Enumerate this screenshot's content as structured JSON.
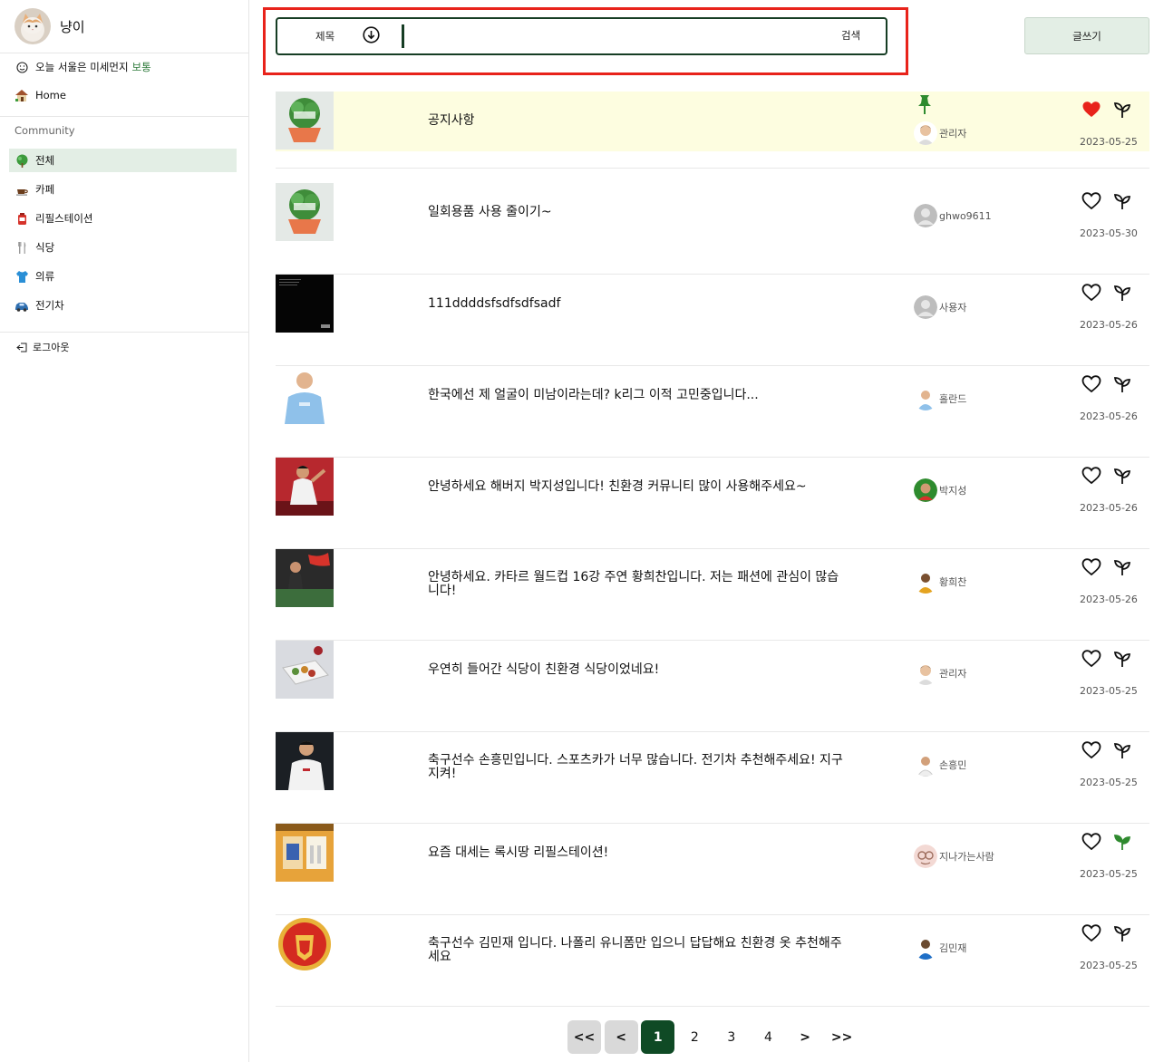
{
  "profile": {
    "name": "냥이"
  },
  "dust": {
    "text": "오늘 서울은 미세먼지",
    "status": "보통"
  },
  "nav": {
    "home": "Home",
    "logout": "로그아웃"
  },
  "community": {
    "label": "Community",
    "items": [
      {
        "label": "전체",
        "icon": "tree-icon",
        "active": true
      },
      {
        "label": "카페",
        "icon": "coffee-icon"
      },
      {
        "label": "리필스테이션",
        "icon": "refill-bottle-icon"
      },
      {
        "label": "식당",
        "icon": "utensils-icon"
      },
      {
        "label": "의류",
        "icon": "shirt-icon"
      },
      {
        "label": "전기차",
        "icon": "car-icon"
      }
    ]
  },
  "search": {
    "type": "제목",
    "placeholder": "",
    "button": "검색"
  },
  "write_button": "글쓰기",
  "colors": {
    "accent": "#0f4a25",
    "active_bg": "#e3eee5",
    "pinned_bg": "#fdfde0",
    "heart": "#e8231b",
    "sprout": "#2f8a2f",
    "highlight": "#e8231b"
  },
  "posts": [
    {
      "title": "공지사항",
      "author": "관리자",
      "date": "2023-05-25",
      "pinned": true,
      "liked": true,
      "sprouted": false
    },
    {
      "title": "일회용품 사용 줄이기~",
      "author": "ghwo9611",
      "date": "2023-05-30",
      "liked": false,
      "sprouted": false
    },
    {
      "title": "111ddddsfsdfsdfsadf",
      "author": "사용자",
      "date": "2023-05-26",
      "liked": false,
      "sprouted": false
    },
    {
      "title": "한국에선 제 얼굴이 미남이라는데? k리그 이적 고민중입니다...",
      "author": "홀란드",
      "date": "2023-05-26",
      "liked": false,
      "sprouted": false
    },
    {
      "title": "안녕하세요 해버지 박지성입니다! 친환경 커뮤니티 많이 사용해주세요~",
      "author": "박지성",
      "date": "2023-05-26",
      "liked": false,
      "sprouted": false
    },
    {
      "title": "안녕하세요. 카타르 월드컵 16강 주연 황희찬입니다. 저는 패션에 관심이 많습니다!",
      "author": "황희찬",
      "date": "2023-05-26",
      "liked": false,
      "sprouted": false
    },
    {
      "title": "우연히 들어간 식당이 친환경 식당이었네요!",
      "author": "관리자",
      "date": "2023-05-25",
      "liked": false,
      "sprouted": false
    },
    {
      "title": "축구선수 손흥민입니다. 스포츠카가 너무 많습니다. 전기차 추천해주세요! 지구지켜!",
      "author": "손흥민",
      "date": "2023-05-25",
      "liked": false,
      "sprouted": false
    },
    {
      "title": "요즘 대세는 록시땅 리필스테이션!",
      "author": "지나가는사람",
      "date": "2023-05-25",
      "liked": false,
      "sprouted": true
    },
    {
      "title": "축구선수 김민재 입니다. 나폴리 유니폼만 입으니 답답해요 친환경 옷 추천해주세요",
      "author": "김민재",
      "date": "2023-05-25",
      "liked": false,
      "sprouted": false
    }
  ],
  "pagination": {
    "first": "<<",
    "prev": "<",
    "pages": [
      "1",
      "2",
      "3",
      "4"
    ],
    "current": "1",
    "next": ">",
    "last": ">>"
  }
}
